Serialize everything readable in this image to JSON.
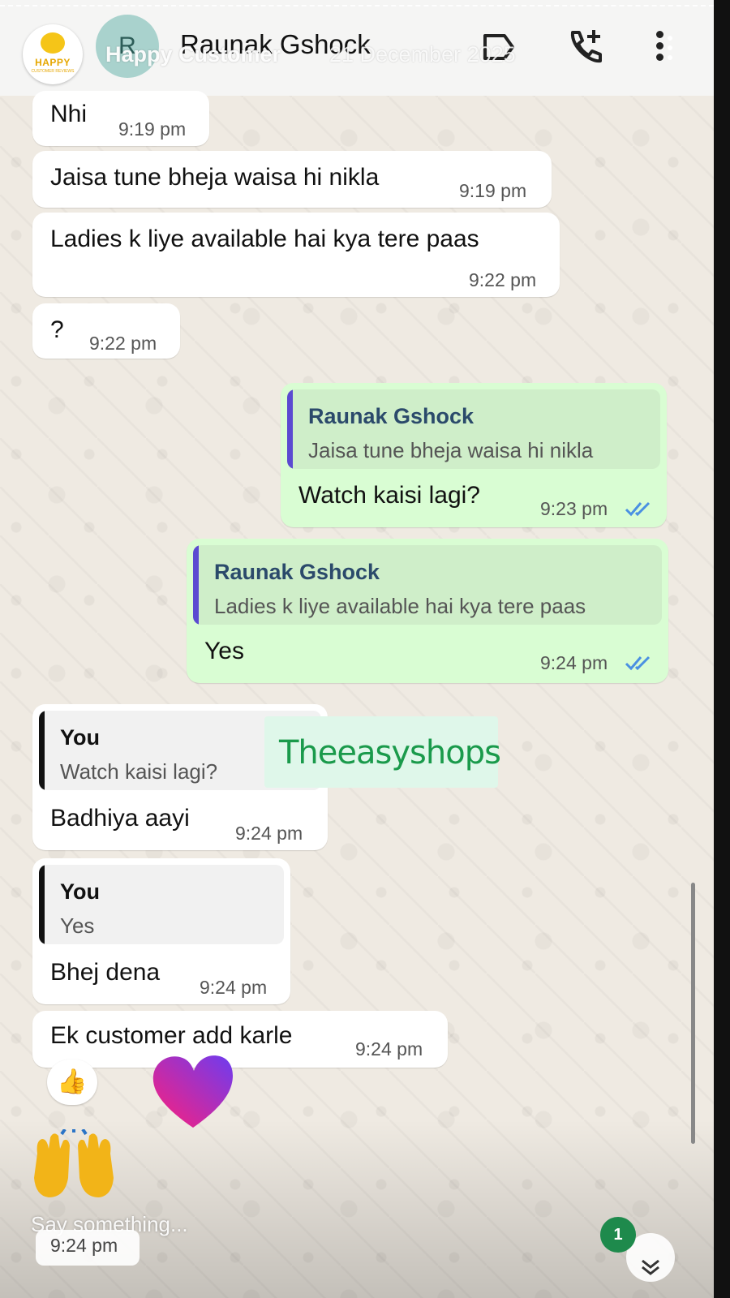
{
  "story": {
    "user": "Happy Customer",
    "date": "21 December 2025",
    "logo_word": "HAPPY",
    "logo_sub": "CUSTOMER REVIEWS",
    "prompt": "Say something...",
    "prompt_time": "9:24 pm"
  },
  "header": {
    "avatar_initial": "R",
    "contact_name": "Raunak Gshock",
    "icons": [
      "label-icon",
      "call-add-icon",
      "more-vert-icon"
    ]
  },
  "messages": [
    {
      "dir": "in",
      "text": "Nhi",
      "time": "9:19 pm"
    },
    {
      "dir": "in",
      "text": "Jaisa tune bheja waisa hi nikla",
      "time": "9:19 pm"
    },
    {
      "dir": "in",
      "text": "Ladies k liye available hai kya tere paas",
      "time": "9:22 pm"
    },
    {
      "dir": "in",
      "text": "?",
      "time": "9:22 pm"
    },
    {
      "dir": "out",
      "quote_name": "Raunak Gshock",
      "quote_text": "Jaisa tune bheja waisa hi nikla",
      "text": "Watch kaisi lagi?",
      "time": "9:23 pm"
    },
    {
      "dir": "out",
      "quote_name": "Raunak Gshock",
      "quote_text": "Ladies k liye available hai kya tere paas",
      "text": "Yes",
      "time": "9:24 pm"
    },
    {
      "dir": "in",
      "quote_name": "You",
      "quote_text": "Watch kaisi lagi?",
      "text": "Badhiya aayi",
      "time": "9:24 pm"
    },
    {
      "dir": "in",
      "quote_name": "You",
      "quote_text": "Yes",
      "text": "Bhej dena",
      "time": "9:24 pm"
    },
    {
      "dir": "in",
      "text": "Ek customer add karle",
      "time": "9:24 pm",
      "reaction": "👍"
    }
  ],
  "sticker_text": "Theeasyshops",
  "unread_count": "1",
  "colors": {
    "incoming": "#ffffff",
    "outgoing": "#d9fdd3",
    "quote_bar_out": "#5b4ad1",
    "quote_bar_in": "#111111",
    "read_ticks": "#4a90e2",
    "sticker_green": "#1a9a4b"
  }
}
